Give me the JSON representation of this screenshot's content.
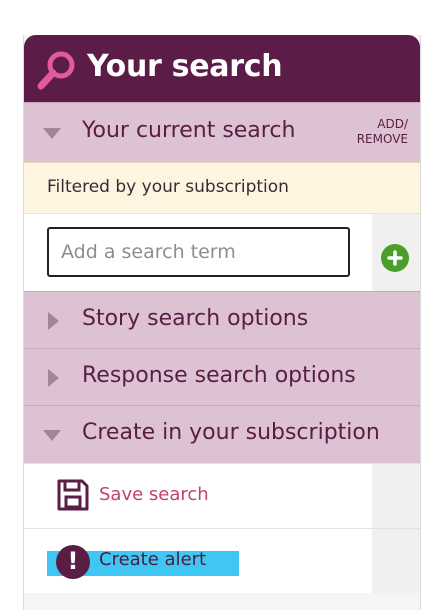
{
  "header": {
    "title": "Your search",
    "icon": "search-icon"
  },
  "current_search": {
    "label": "Your current search",
    "add_remove": [
      "ADD/",
      "REMOVE"
    ]
  },
  "filter_note": "Filtered by your subscription",
  "search": {
    "placeholder": "Add a search term",
    "value": "",
    "add_icon": "plus-icon"
  },
  "sections": {
    "story": "Story search options",
    "response": "Response search options",
    "create": "Create in your subscription"
  },
  "actions": {
    "save": {
      "label": "Save search",
      "icon": "floppy-disk-icon"
    },
    "alert": {
      "label": "Create alert",
      "icon": "exclamation-icon"
    }
  },
  "colors": {
    "header_bg": "#5c1c48",
    "section_bg": "#dcc2d2",
    "filter_bg": "#fdf5e0",
    "accent_link": "#c23f73",
    "add_button": "#4a9e2a",
    "highlight": "#3fc6f2"
  }
}
